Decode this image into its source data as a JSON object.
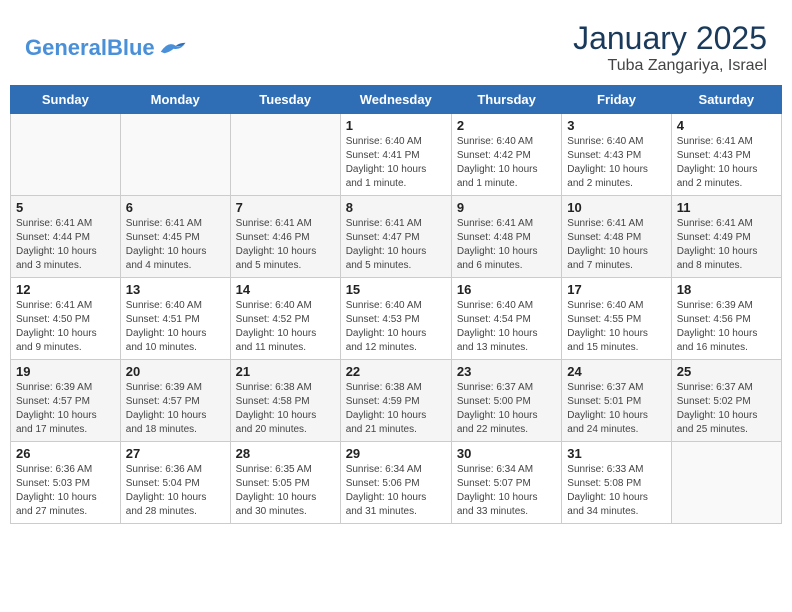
{
  "header": {
    "logo_text_general": "General",
    "logo_text_blue": "Blue",
    "month": "January 2025",
    "location": "Tuba Zangariya, Israel"
  },
  "days_of_week": [
    "Sunday",
    "Monday",
    "Tuesday",
    "Wednesday",
    "Thursday",
    "Friday",
    "Saturday"
  ],
  "weeks": [
    [
      {
        "num": "",
        "info": ""
      },
      {
        "num": "",
        "info": ""
      },
      {
        "num": "",
        "info": ""
      },
      {
        "num": "1",
        "info": "Sunrise: 6:40 AM\nSunset: 4:41 PM\nDaylight: 10 hours\nand 1 minute."
      },
      {
        "num": "2",
        "info": "Sunrise: 6:40 AM\nSunset: 4:42 PM\nDaylight: 10 hours\nand 1 minute."
      },
      {
        "num": "3",
        "info": "Sunrise: 6:40 AM\nSunset: 4:43 PM\nDaylight: 10 hours\nand 2 minutes."
      },
      {
        "num": "4",
        "info": "Sunrise: 6:41 AM\nSunset: 4:43 PM\nDaylight: 10 hours\nand 2 minutes."
      }
    ],
    [
      {
        "num": "5",
        "info": "Sunrise: 6:41 AM\nSunset: 4:44 PM\nDaylight: 10 hours\nand 3 minutes."
      },
      {
        "num": "6",
        "info": "Sunrise: 6:41 AM\nSunset: 4:45 PM\nDaylight: 10 hours\nand 4 minutes."
      },
      {
        "num": "7",
        "info": "Sunrise: 6:41 AM\nSunset: 4:46 PM\nDaylight: 10 hours\nand 5 minutes."
      },
      {
        "num": "8",
        "info": "Sunrise: 6:41 AM\nSunset: 4:47 PM\nDaylight: 10 hours\nand 5 minutes."
      },
      {
        "num": "9",
        "info": "Sunrise: 6:41 AM\nSunset: 4:48 PM\nDaylight: 10 hours\nand 6 minutes."
      },
      {
        "num": "10",
        "info": "Sunrise: 6:41 AM\nSunset: 4:48 PM\nDaylight: 10 hours\nand 7 minutes."
      },
      {
        "num": "11",
        "info": "Sunrise: 6:41 AM\nSunset: 4:49 PM\nDaylight: 10 hours\nand 8 minutes."
      }
    ],
    [
      {
        "num": "12",
        "info": "Sunrise: 6:41 AM\nSunset: 4:50 PM\nDaylight: 10 hours\nand 9 minutes."
      },
      {
        "num": "13",
        "info": "Sunrise: 6:40 AM\nSunset: 4:51 PM\nDaylight: 10 hours\nand 10 minutes."
      },
      {
        "num": "14",
        "info": "Sunrise: 6:40 AM\nSunset: 4:52 PM\nDaylight: 10 hours\nand 11 minutes."
      },
      {
        "num": "15",
        "info": "Sunrise: 6:40 AM\nSunset: 4:53 PM\nDaylight: 10 hours\nand 12 minutes."
      },
      {
        "num": "16",
        "info": "Sunrise: 6:40 AM\nSunset: 4:54 PM\nDaylight: 10 hours\nand 13 minutes."
      },
      {
        "num": "17",
        "info": "Sunrise: 6:40 AM\nSunset: 4:55 PM\nDaylight: 10 hours\nand 15 minutes."
      },
      {
        "num": "18",
        "info": "Sunrise: 6:39 AM\nSunset: 4:56 PM\nDaylight: 10 hours\nand 16 minutes."
      }
    ],
    [
      {
        "num": "19",
        "info": "Sunrise: 6:39 AM\nSunset: 4:57 PM\nDaylight: 10 hours\nand 17 minutes."
      },
      {
        "num": "20",
        "info": "Sunrise: 6:39 AM\nSunset: 4:57 PM\nDaylight: 10 hours\nand 18 minutes."
      },
      {
        "num": "21",
        "info": "Sunrise: 6:38 AM\nSunset: 4:58 PM\nDaylight: 10 hours\nand 20 minutes."
      },
      {
        "num": "22",
        "info": "Sunrise: 6:38 AM\nSunset: 4:59 PM\nDaylight: 10 hours\nand 21 minutes."
      },
      {
        "num": "23",
        "info": "Sunrise: 6:37 AM\nSunset: 5:00 PM\nDaylight: 10 hours\nand 22 minutes."
      },
      {
        "num": "24",
        "info": "Sunrise: 6:37 AM\nSunset: 5:01 PM\nDaylight: 10 hours\nand 24 minutes."
      },
      {
        "num": "25",
        "info": "Sunrise: 6:37 AM\nSunset: 5:02 PM\nDaylight: 10 hours\nand 25 minutes."
      }
    ],
    [
      {
        "num": "26",
        "info": "Sunrise: 6:36 AM\nSunset: 5:03 PM\nDaylight: 10 hours\nand 27 minutes."
      },
      {
        "num": "27",
        "info": "Sunrise: 6:36 AM\nSunset: 5:04 PM\nDaylight: 10 hours\nand 28 minutes."
      },
      {
        "num": "28",
        "info": "Sunrise: 6:35 AM\nSunset: 5:05 PM\nDaylight: 10 hours\nand 30 minutes."
      },
      {
        "num": "29",
        "info": "Sunrise: 6:34 AM\nSunset: 5:06 PM\nDaylight: 10 hours\nand 31 minutes."
      },
      {
        "num": "30",
        "info": "Sunrise: 6:34 AM\nSunset: 5:07 PM\nDaylight: 10 hours\nand 33 minutes."
      },
      {
        "num": "31",
        "info": "Sunrise: 6:33 AM\nSunset: 5:08 PM\nDaylight: 10 hours\nand 34 minutes."
      },
      {
        "num": "",
        "info": ""
      }
    ]
  ]
}
